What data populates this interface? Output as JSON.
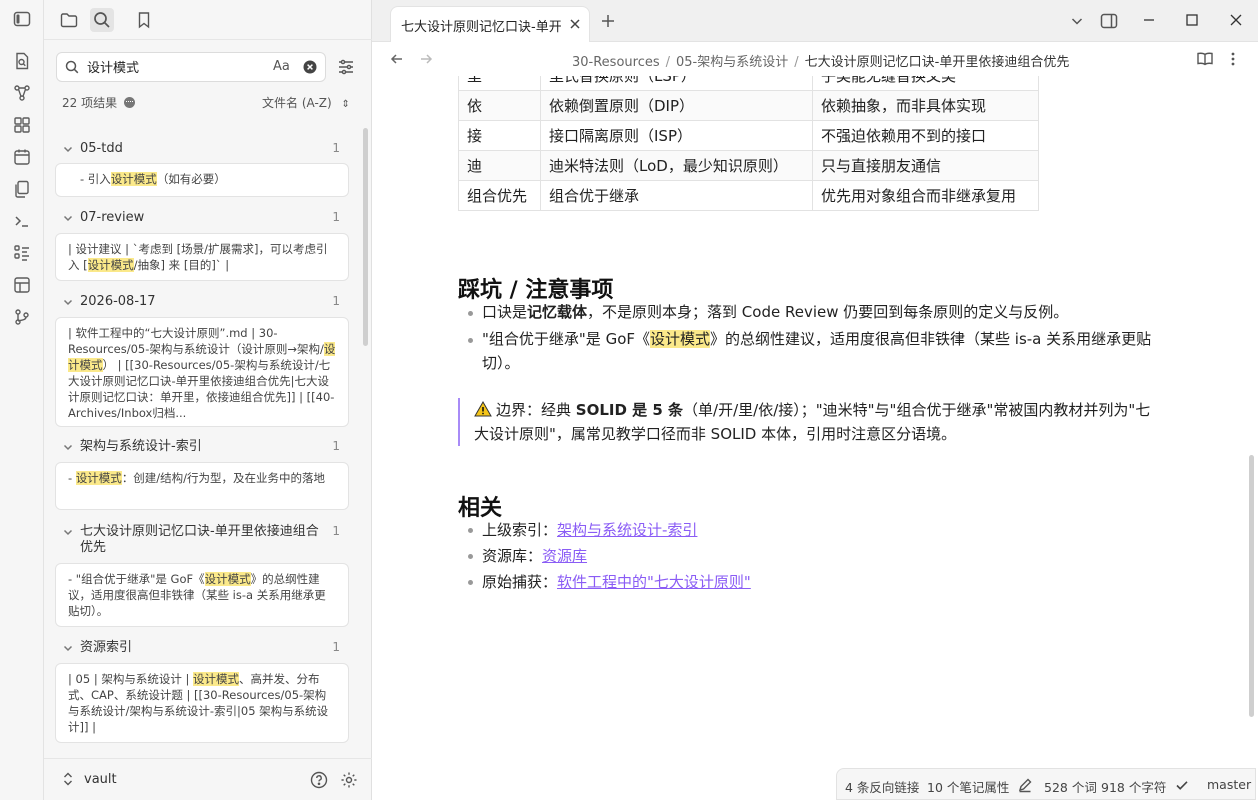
{
  "search": {
    "value": "设计模式",
    "case_toggle": "Aa"
  },
  "results_summary": {
    "count": "22 项结果",
    "sort": "文件名 (A-Z)"
  },
  "results": [
    {
      "file": "05-tdd",
      "count": "1",
      "snippet_pre": "- 引入",
      "snippet_hl": "设计模式",
      "snippet_post": "（如有必要）"
    },
    {
      "file": "07-review",
      "count": "1",
      "snippet_pre": "| 设计建议 | `考虑到 [场景/扩展需求]，可以考虑引入 [",
      "snippet_hl": "设计模式",
      "snippet_post": "/抽象] 来 [目的]` |"
    },
    {
      "file": "2026-08-17",
      "count": "1",
      "snippet_pre": "| 软件工程中的“七大设计原则”.md | 30-Resources/05-架构与系统设计（设计原则→架构/",
      "snippet_hl": "设计模式",
      "snippet_post": "） | [[30-Resources/05-架构与系统设计/七大设计原则记忆口诀-单开里依接迪组合优先|七大设计原则记忆口诀：单开里，依接迪组合优先]] | [[40-Archives/Inbox归档..."
    },
    {
      "file": "架构与系统设计-索引",
      "count": "1",
      "snippet_pre": "- ",
      "snippet_hl": "设计模式",
      "snippet_post": "：创建/结构/行为型，及在业务中的落地"
    },
    {
      "file": "七大设计原则记忆口诀-单开里依接迪组合优先",
      "count": "1",
      "snippet_pre": "- \"组合优于继承\"是 GoF《",
      "snippet_hl": "设计模式",
      "snippet_post": "》的总纲性建议，适用度很高但非铁律（某些 is-a 关系用继承更贴切）。"
    },
    {
      "file": "资源索引",
      "count": "1",
      "snippet_pre": "| 05 | 架构与系统设计 | ",
      "snippet_hl": "设计模式",
      "snippet_post": "、高并发、分布式、CAP、系统设计题 | [[30-Resources/05-架构与系统设计/架构与系统设计-索引|05 架构与系统设计]] |"
    }
  ],
  "vault_name": "vault",
  "tab": {
    "title": "七大设计原则记忆口诀-单开里依接迪组合优先"
  },
  "breadcrumb": {
    "p1": "30-Resources",
    "p2": "05-架构与系统设计",
    "p3": "七大设计原则记忆口诀-单开里依接迪组合优先"
  },
  "table_rows": [
    {
      "k": "里",
      "principle": "里氏替换原则（LSP）",
      "desc": "子类能无缝替换父类"
    },
    {
      "k": "依",
      "principle": "依赖倒置原则（DIP）",
      "desc": "依赖抽象，而非具体实现"
    },
    {
      "k": "接",
      "principle": "接口隔离原则（ISP）",
      "desc": "不强迫依赖用不到的接口"
    },
    {
      "k": "迪",
      "principle": "迪米特法则（LoD，最少知识原则）",
      "desc": "只与直接朋友通信"
    },
    {
      "k": "组合优先",
      "principle": "组合优于继承",
      "desc": "优先用对象组合而非继承复用"
    }
  ],
  "pitfalls": {
    "heading": "踩坑 / 注意事项",
    "b1_pre": "口诀是",
    "b1_bold": "记忆载体",
    "b1_post": "，不是原则本身；落到 Code Review 仍要回到每条原则的定义与反例。",
    "b2_pre": "\"组合优于继承\"是 GoF《",
    "b2_hl": "设计模式",
    "b2_post": "》的总纲性建议，适用度很高但非铁律（某些 is-a 关系用继承更贴切）。"
  },
  "callout": {
    "pre": "边界：经典 ",
    "bold": "SOLID 是 5 条",
    "post": "（单/开/里/依/接）；\"迪米特\"与\"组合优于继承\"常被国内教材并列为\"七大设计原则\"，属常见教学口径而非 SOLID 本体，引用时注意区分语境。"
  },
  "related": {
    "heading": "相关",
    "items": [
      {
        "label": "上级索引：",
        "link": "架构与系统设计-索引"
      },
      {
        "label": "资源库：",
        "link": "资源库"
      },
      {
        "label": "原始捕获：",
        "link": "软件工程中的\"七大设计原则\""
      }
    ]
  },
  "status": {
    "backlinks": "4 条反向链接",
    "props": "10 个笔记属性",
    "words": "528 个词",
    "chars": "918 个字符",
    "branch": "master"
  },
  "colors": {
    "highlight": "#fbe98a",
    "link": "#8a5cf5",
    "callout_border": "#a88bf7"
  }
}
